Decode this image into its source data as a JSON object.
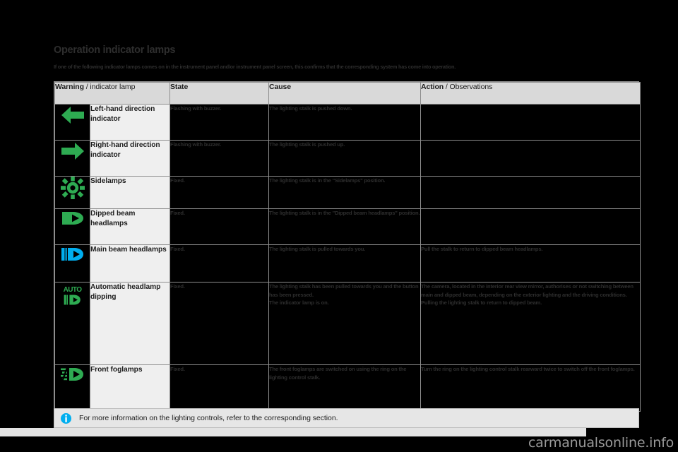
{
  "document": {
    "title": "Operation indicator lamps",
    "subtitle": "If one of the following indicator lamps comes on in the instrument panel and/or instrument panel screen, this confirms that the corresponding system has come into operation."
  },
  "table": {
    "headers": {
      "lamp_bold": "Warning",
      "lamp_rest": " / indicator lamp",
      "state": "State",
      "cause": "Cause",
      "action_bold": "Action",
      "action_rest": " / Observations"
    },
    "rows": [
      {
        "icon": "turn-signal-left-icon",
        "icon_color": "#2eab52",
        "name": "Left-hand direction indicator",
        "state": "Flashing with buzzer.",
        "cause": "The lighting stalk is pushed down.",
        "action": ""
      },
      {
        "icon": "turn-signal-right-icon",
        "icon_color": "#2eab52",
        "name": "Right-hand direction indicator",
        "state": "Flashing with buzzer.",
        "cause": "The lighting stalk is pushed up.",
        "action": ""
      },
      {
        "icon": "sidelamps-icon",
        "icon_color": "#2eab52",
        "name": "Sidelamps",
        "state": "Fixed.",
        "cause": "The lighting stalk is in the \"Sidelamps\" position.",
        "action": ""
      },
      {
        "icon": "dipped-beam-icon",
        "icon_color": "#2eab52",
        "name": "Dipped beam headlamps",
        "state": "Fixed.",
        "cause": "The lighting stalk is in the \"Dipped beam headlamps\" position.",
        "action": ""
      },
      {
        "icon": "main-beam-icon",
        "icon_color": "#00aeef",
        "name": "Main beam headlamps",
        "state": "Fixed.",
        "cause": "The lighting stalk is pulled towards you.",
        "action": "Pull the stalk to return to dipped beam headlamps."
      },
      {
        "icon": "automatic-headlamp-dipping-icon",
        "icon_color": "#2eab52",
        "icon_text": "AUTO",
        "name": "Automatic headlamp dipping",
        "state": "Fixed.",
        "cause_line1": "The lighting stalk has been pulled towards you and the button has been pressed.",
        "cause_line2": "The indicator lamp is on.",
        "action_line1": "The camera, located in the interior rear view mirror, authorises or not switching between main and dipped beam, depending on the exterior lighting and the driving conditions.",
        "action_line2": "Pulling the lighting stalk to return to dipped beam."
      },
      {
        "icon": "front-foglamps-icon",
        "icon_color": "#2eab52",
        "name": "Front foglamps",
        "state": "Fixed.",
        "cause": "The front foglamps are switched on using the ring on the lighting control stalk.",
        "action": "Turn the ring on the lighting control stalk rearward twice to switch off the front foglamps."
      }
    ]
  },
  "note": {
    "icon": "info-icon",
    "icon_color": "#00aeef",
    "text": "For more information on the lighting controls, refer to the corresponding section."
  },
  "watermark": {
    "text": "carmanualsonline.info"
  }
}
